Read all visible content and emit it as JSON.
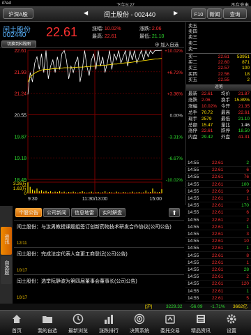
{
  "status_bar": {
    "device": "iPad",
    "time": "下午5:27",
    "right": "不在充电"
  },
  "title_bar": {
    "market_button": "沪深A股",
    "prev": "◀",
    "title": "闰土股份 - 002440",
    "next": "▶",
    "f10": "F10",
    "refresh": "新闻",
    "query": "查询"
  },
  "stock": {
    "name": "闰土股份",
    "code": "002440",
    "kline_button": "切换到K线图",
    "price": "22.61",
    "add_button": "加入自选",
    "stats": {
      "change_pct_label": "涨幅:",
      "change_pct": "10.02%",
      "change_label": "涨跌:",
      "change": "2.06",
      "high_label": "最高:",
      "high": "22.61",
      "low_label": "最低:",
      "low": "21.10"
    }
  },
  "chart_data": {
    "type": "line",
    "title": "",
    "prev_close": 20.55,
    "price_ticks": [
      "22.61",
      "21.93",
      "21.24",
      "20.55",
      "19.87",
      "19.18",
      "18.49"
    ],
    "pct_ticks": [
      "+10.02%",
      "+6.72%",
      "+3.36%",
      "0.00%",
      "-3.31%",
      "-6.67%",
      "-10.02%"
    ],
    "time_ticks": [
      "9:30",
      "11:30/13:00",
      "15:00"
    ],
    "volume_ticks": [
      "3.26万",
      "1.63万",
      "0"
    ],
    "ylim": [
      18.49,
      22.61
    ],
    "price_series": [
      21.2,
      21.9,
      21.6,
      22.2,
      22.4,
      22.0,
      22.5,
      21.9,
      22.6,
      21.7,
      22.1,
      22.3,
      21.9,
      22.4,
      22.0,
      22.5,
      22.6,
      22.3,
      21.7,
      22.1,
      21.9,
      22.2,
      22.4,
      21.6,
      22.0,
      22.6,
      22.1,
      21.8,
      22.3,
      22.5,
      22.0,
      22.6,
      22.1,
      22.4,
      21.9,
      22.2,
      22.6,
      22.0,
      22.5,
      22.3,
      22.6,
      22.2,
      22.4,
      22.6,
      22.1,
      22.6,
      22.3,
      22.6,
      22.2,
      22.4,
      22.6,
      22.3,
      22.6,
      22.4,
      22.6,
      22.5,
      22.6,
      22.6,
      22.6,
      22.61
    ],
    "avg_series": [
      21.6,
      21.75,
      21.82,
      21.88,
      21.92,
      21.95,
      21.98,
      21.99,
      22.0,
      22.0,
      22.01,
      22.02,
      22.02,
      22.03,
      22.03,
      22.04,
      22.05,
      22.05,
      22.05,
      22.05,
      22.06,
      22.06,
      22.07,
      22.07,
      22.07,
      22.08,
      22.09,
      22.09,
      22.1,
      22.1,
      22.11,
      22.12,
      22.12,
      22.13,
      22.13,
      22.14,
      22.15,
      22.16,
      22.17,
      22.17,
      22.18,
      22.19,
      22.2,
      22.21,
      22.21,
      22.22,
      22.23,
      22.24,
      22.25,
      22.26,
      22.27,
      22.28,
      22.29,
      22.3,
      22.31,
      22.32,
      22.33,
      22.33,
      22.34,
      22.35
    ],
    "volume_series": [
      3.2,
      1.9,
      1.1,
      0.8,
      1.4,
      0.6,
      0.9,
      0.5,
      0.7,
      0.4,
      0.6,
      0.3,
      0.5,
      0.4,
      0.6,
      0.3,
      0.5,
      0.2,
      0.4,
      0.3,
      0.5,
      0.3,
      0.2,
      0.4,
      0.6,
      0.3,
      0.2,
      0.3,
      0.5,
      0.2,
      0.3,
      0.4,
      0.2,
      0.3,
      0.6,
      0.2,
      0.4,
      0.3,
      0.2,
      0.5,
      0.3,
      0.2,
      0.4,
      0.3,
      0.2,
      0.3,
      0.5,
      0.2,
      0.3,
      0.4,
      0.2,
      0.3,
      0.8,
      0.3,
      0.4,
      1.4,
      0.5,
      0.3,
      0.4,
      1.2
    ]
  },
  "orderbook": {
    "asks": [
      {
        "label": "卖五",
        "price": "",
        "vol": ""
      },
      {
        "label": "卖四",
        "price": "",
        "vol": ""
      },
      {
        "label": "卖三",
        "price": "",
        "vol": ""
      },
      {
        "label": "卖二",
        "price": "",
        "vol": ""
      },
      {
        "label": "卖一",
        "price": "",
        "vol": ""
      }
    ],
    "bids": [
      {
        "label": "买一",
        "price": "22.61",
        "vol": "53951"
      },
      {
        "label": "买二",
        "price": "22.60",
        "vol": "871"
      },
      {
        "label": "买三",
        "price": "22.57",
        "vol": "100"
      },
      {
        "label": "买四",
        "price": "22.56",
        "vol": "18"
      },
      {
        "label": "买五",
        "price": "22.55",
        "vol": "2"
      }
    ],
    "divider": "逐笔",
    "stats": [
      [
        "最新",
        "22.61",
        "均价",
        "21.87"
      ],
      [
        "涨跌",
        "2.06",
        "换手",
        "15.89%"
      ],
      [
        "涨幅",
        "10.02%",
        "今开",
        "21.35"
      ],
      [
        "总手",
        "70.72",
        "最高",
        "22.61"
      ],
      [
        "现手",
        "2579",
        "最低",
        "21.10"
      ],
      [
        "总额",
        "15.47",
        "量比",
        "1.46"
      ],
      [
        "涨停",
        "22.61",
        "跌停",
        "18.50"
      ],
      [
        "内盘",
        "29.42",
        "外盘",
        "41.31"
      ]
    ]
  },
  "trades": [
    [
      "14:55",
      "22.61",
      "2"
    ],
    [
      "14:55",
      "22.61",
      "6"
    ],
    [
      "14:55",
      "22.61",
      "76"
    ],
    [
      "14:55",
      "22.61",
      "100"
    ],
    [
      "14:55",
      "22.61",
      "9"
    ],
    [
      "14:55",
      "22.61",
      "1"
    ],
    [
      "14:55",
      "22.61",
      "170"
    ],
    [
      "14:55",
      "22.61",
      "6"
    ],
    [
      "14:55",
      "22.61",
      "2"
    ],
    [
      "14:55",
      "22.61",
      "1"
    ],
    [
      "14:55",
      "22.61",
      "3"
    ],
    [
      "14:55",
      "22.61",
      "10"
    ],
    [
      "14:55",
      "22.61",
      "1"
    ],
    [
      "14:55",
      "22.61",
      "8"
    ],
    [
      "14:55",
      "22.61",
      "1"
    ],
    [
      "14:55",
      "22.61",
      "28"
    ],
    [
      "14:55",
      "22.61",
      "2"
    ],
    [
      "14:55",
      "22.61",
      "120"
    ],
    [
      "14:55",
      "22.61",
      "1"
    ],
    [
      "14:55",
      "22.61",
      "5"
    ]
  ],
  "news_panel": {
    "side_tabs": [
      "资讯",
      "自选股"
    ],
    "tabs": [
      "个股公告",
      "公司新闻",
      "信息地雷",
      "实时解盘"
    ],
    "up_button": "⬆",
    "items": [
      {
        "title": "闰土股份：与汝男教授课题组签订创新药物技术研发合作协议(公司公告)",
        "date": "12/11"
      },
      {
        "title": "闰土股份：完成法定代表人变更工商登记(公司公告)",
        "date": "10/17"
      },
      {
        "title": "闰土股份：选举阮静波为第四届董事会董事长(公司公告)",
        "date": "10/17"
      }
    ]
  },
  "index_bar": {
    "name": "[沪]",
    "value": "3229.32",
    "change": "-56.09",
    "pct": "-1.71%",
    "amount": "3662亿"
  },
  "tabbar": [
    {
      "label": "首页",
      "icon": "home-icon"
    },
    {
      "label": "我的自选",
      "icon": "folder-icon"
    },
    {
      "label": "最新浏览",
      "icon": "clock-icon"
    },
    {
      "label": "涨跌排行",
      "icon": "ranking-icon"
    },
    {
      "label": "决策系统",
      "icon": "target-icon"
    },
    {
      "label": "委托交易",
      "icon": "trade-icon"
    },
    {
      "label": "精品资讯",
      "icon": "news-icon"
    },
    {
      "label": "设置",
      "icon": "gear-icon"
    }
  ]
}
